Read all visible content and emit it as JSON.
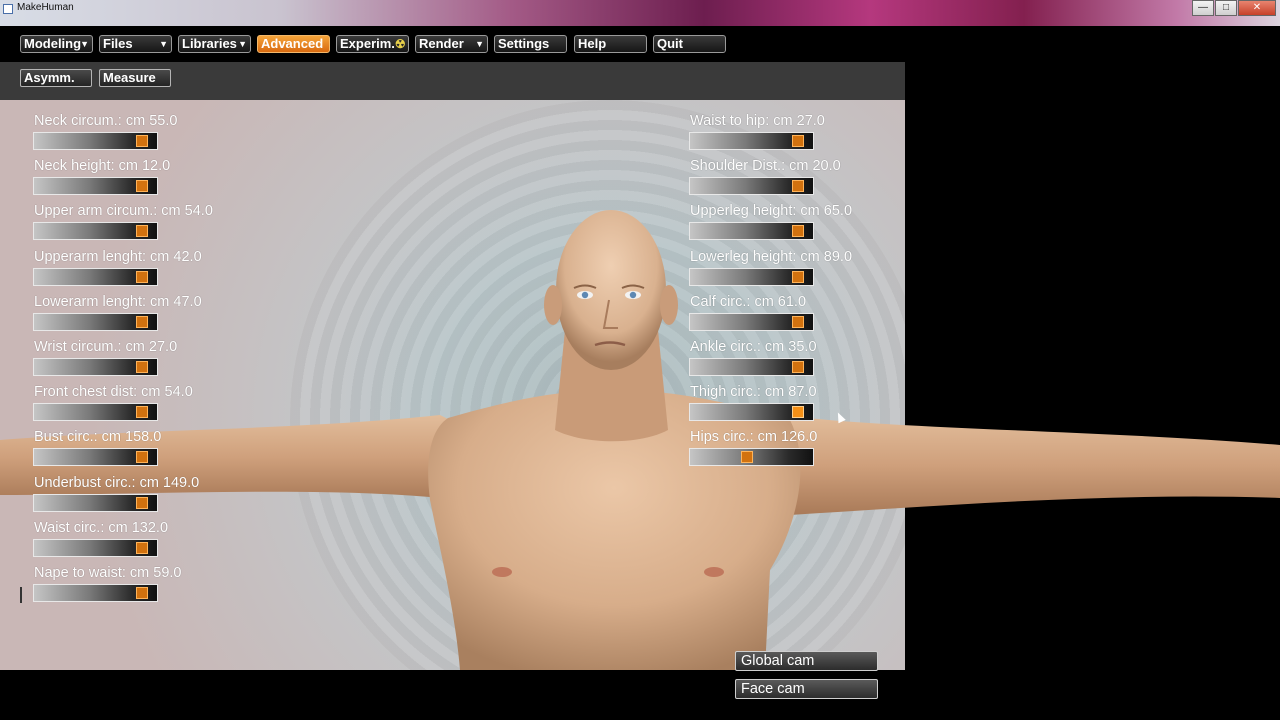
{
  "window": {
    "title": "MakeHuman"
  },
  "menu": [
    {
      "label": "Modeling",
      "dropdown": true
    },
    {
      "label": "Files",
      "dropdown": true
    },
    {
      "label": "Libraries",
      "dropdown": true
    },
    {
      "label": "Advanced",
      "dropdown": false,
      "active": true
    },
    {
      "label": "Experim.",
      "dropdown": false,
      "icon": "radiation-icon"
    },
    {
      "label": "Render",
      "dropdown": true
    },
    {
      "label": "Settings",
      "dropdown": false
    },
    {
      "label": "Help",
      "dropdown": false
    },
    {
      "label": "Quit",
      "dropdown": false
    }
  ],
  "toolbar": {
    "asymm_label": "Asymm.",
    "measure_label": "Measure"
  },
  "left_sliders": [
    {
      "label": "Neck circum.: cm 55.0",
      "level": 0.92
    },
    {
      "label": "Neck height: cm 12.0",
      "level": 0.92
    },
    {
      "label": "Upper arm circum.: cm 54.0",
      "level": 0.92
    },
    {
      "label": "Upperarm lenght: cm 42.0",
      "level": 0.92
    },
    {
      "label": "Lowerarm lenght: cm 47.0",
      "level": 0.92
    },
    {
      "label": "Wrist circum.: cm 27.0",
      "level": 0.92
    },
    {
      "label": "Front chest dist: cm 54.0",
      "level": 0.92
    },
    {
      "label": "Bust circ.: cm 158.0",
      "level": 0.92
    },
    {
      "label": "Underbust circ.: cm 149.0",
      "level": 0.92
    },
    {
      "label": "Waist circ.: cm 132.0",
      "level": 0.92
    },
    {
      "label": "Nape to waist: cm 59.0",
      "level": 0.92
    }
  ],
  "right_sliders": [
    {
      "label": "Waist to hip: cm 27.0",
      "level": 0.92
    },
    {
      "label": "Shoulder Dist.: cm 20.0",
      "level": 0.92
    },
    {
      "label": "Upperleg height: cm 65.0",
      "level": 0.92
    },
    {
      "label": "Lowerleg height: cm 89.0",
      "level": 0.92
    },
    {
      "label": "Calf circ.: cm 61.0",
      "level": 0.92
    },
    {
      "label": "Ankle circ.: cm 35.0",
      "level": 0.92
    },
    {
      "label": "Thigh circ.: cm 87.0",
      "level": 0.92,
      "hover": true
    },
    {
      "label": "Hips circ.: cm 126.0",
      "level": 0.5
    }
  ],
  "camera": {
    "global_label": "Global cam",
    "face_label": "Face cam"
  },
  "colors": {
    "accent": "#d96a10",
    "thumb": "#d2720f",
    "skin": "#d7ad8a"
  }
}
